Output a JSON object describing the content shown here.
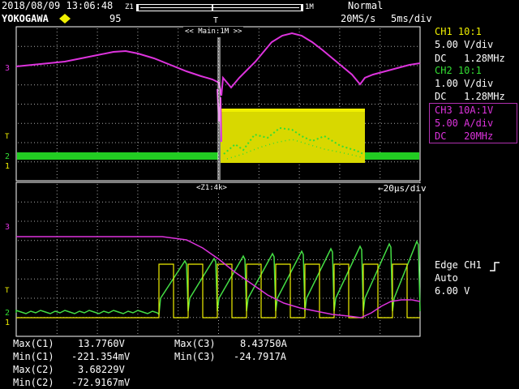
{
  "header": {
    "datetime": "2018/08/09 13:06:48",
    "brand": "YOKOGAWA",
    "record_count": "95",
    "zoom_left_label": "Z1",
    "zoom_right_label": "1M",
    "trigger_mode": "Normal",
    "sample_rate": "20MS/s",
    "timebase": "5ms/div"
  },
  "main_window": {
    "label": "<< Main:1M >>"
  },
  "zoom_window": {
    "label": "<Z1:4k>",
    "timebase": "←20μs/div"
  },
  "channels": [
    {
      "id": "ch1",
      "title": "CH1 10:1",
      "scale": "5.00 V/div",
      "coupling": "DC   1.28MHz",
      "color": "#f0f000"
    },
    {
      "id": "ch2",
      "title": "CH2 10:1",
      "scale": "1.00 V/div",
      "coupling": "DC   1.28MHz",
      "color": "#33dd33"
    },
    {
      "id": "ch3",
      "title": "CH3 10A:1V",
      "scale": "5.00 A/div",
      "coupling": "DC   20MHz",
      "color": "#dd33dd"
    }
  ],
  "trigger": {
    "type": "Edge CH1",
    "mode": "Auto",
    "level": "6.00 V"
  },
  "measurements": {
    "left": [
      {
        "label": "Max(C1)",
        "value": "13.7760V"
      },
      {
        "label": "Min(C1)",
        "value": "-221.354mV"
      },
      {
        "label": "Max(C2)",
        "value": "3.68229V"
      },
      {
        "label": "Min(C2)",
        "value": "-72.9167mV"
      }
    ],
    "right": [
      {
        "label": "Max(C3)",
        "value": "8.43750A"
      },
      {
        "label": "Min(C3)",
        "value": "-24.7917A"
      }
    ]
  },
  "colors": {
    "ch1": "#f0f000",
    "ch2": "#33dd33",
    "ch3": "#dd33dd",
    "grid": "#ffffff",
    "selected_box": "#b030b0"
  }
}
